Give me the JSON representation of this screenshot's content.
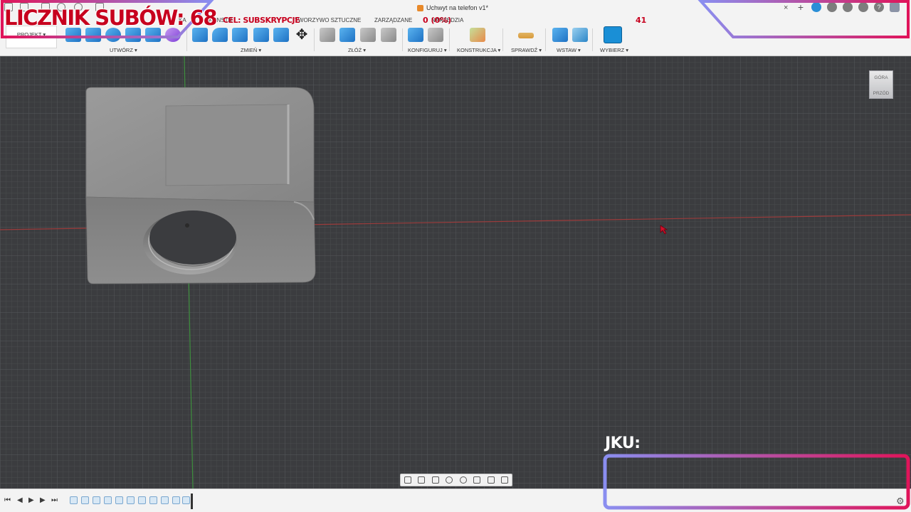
{
  "window": {
    "document_title": "Uchwyt na telefon v1*",
    "close_tab_glyph": "×"
  },
  "tabs": [
    "KONSTR",
    "TWORZYWO SZTUCZNE",
    "ZARZĄDZANE",
    "NARZĘDZIA",
    "KA"
  ],
  "toolbar": {
    "project_label": "PROJEKT ▾",
    "groups": {
      "create": "UTWÓRZ ▾",
      "modify": "ZMIEŃ ▾",
      "assemble": "ZŁÓŻ ▾",
      "configure": "KONFIGURUJ ▾",
      "construct": "KONSTRUKCJA ▾",
      "inspect": "SPRAWDŹ ▾",
      "insert": "WSTAW ▾",
      "select": "WYBIERZ ▾"
    }
  },
  "viewcube": {
    "top_label": "GÓRA",
    "front_label": "PRZÓD"
  },
  "overlay": {
    "subs_counter": "LICZNIK SUBÓW: 68",
    "goal_label": "CEL: SUBSKRYPCJE",
    "goal_progress": "0 (0%)",
    "goal_target": "41",
    "chat_label": "JKU:"
  },
  "timeline": {
    "controls": [
      "⏮",
      "◀",
      "▶",
      "▶",
      "⏭"
    ],
    "settings_glyph": "⚙"
  },
  "colors": {
    "overlay_red": "#c7001e",
    "overlay_gradient_start": "#8a8ef0",
    "overlay_gradient_end": "#e0145a",
    "viewport_bg": "#3b3c3f",
    "toolbar_bg": "#f3f3f3",
    "x_axis": "#9c3b3b",
    "y_axis": "#3e8f3e",
    "model_gray": "#8d8d8d"
  },
  "icons": [
    "search-icon",
    "help-icon",
    "bell-icon",
    "user-avatar-icon",
    "move-icon",
    "gear-icon"
  ]
}
